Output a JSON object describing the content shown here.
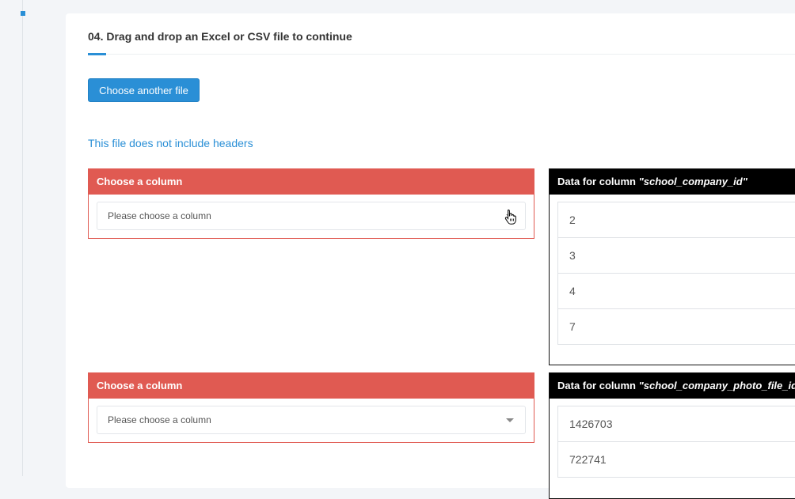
{
  "step": {
    "title": "04. Drag and drop an Excel or CSV file to continue",
    "choose_file_label": "Choose another file",
    "notice": "This file does not include headers"
  },
  "mappings": [
    {
      "column_header": "Choose a column",
      "select_placeholder": "Please choose a column",
      "data_header_prefix": "Data for column ",
      "data_column_name": "\"school_company_id\"",
      "values": [
        "2",
        "3",
        "4",
        "7"
      ]
    },
    {
      "column_header": "Choose a column",
      "select_placeholder": "Please choose a column",
      "data_header_prefix": "Data for column ",
      "data_column_name": "\"school_company_photo_file_id\"",
      "values": [
        "1426703",
        "722741"
      ]
    }
  ],
  "colors": {
    "accent": "#2a8fd6",
    "error": "#e05a52",
    "dark": "#000000"
  }
}
